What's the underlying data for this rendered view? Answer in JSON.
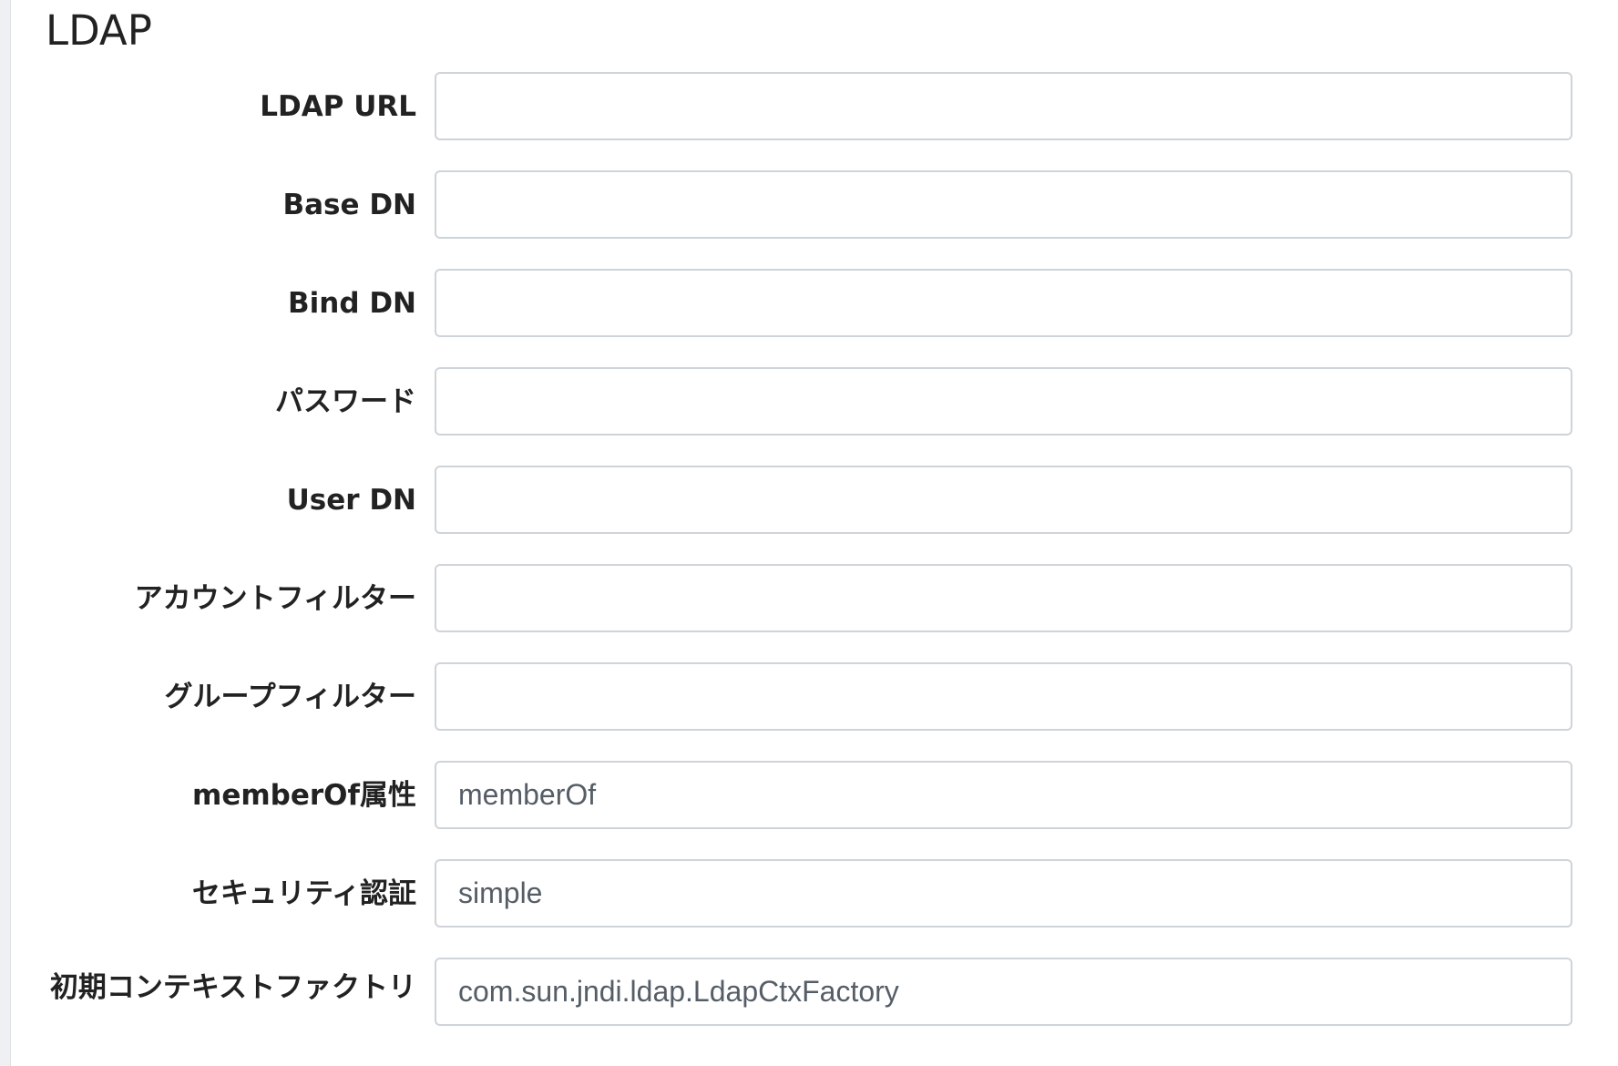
{
  "section": {
    "title": "LDAP"
  },
  "fields": [
    {
      "key": "ldap-url",
      "label": "LDAP URL",
      "value": "",
      "placeholder": ""
    },
    {
      "key": "base-dn",
      "label": "Base DN",
      "value": "",
      "placeholder": ""
    },
    {
      "key": "bind-dn",
      "label": "Bind DN",
      "value": "",
      "placeholder": ""
    },
    {
      "key": "password",
      "label": "パスワード",
      "value": "",
      "placeholder": ""
    },
    {
      "key": "user-dn",
      "label": "User DN",
      "value": "",
      "placeholder": ""
    },
    {
      "key": "account-filter",
      "label": "アカウントフィルター",
      "value": "",
      "placeholder": ""
    },
    {
      "key": "group-filter",
      "label": "グループフィルター",
      "value": "",
      "placeholder": ""
    },
    {
      "key": "memberof-attribute",
      "label": "memberOf属性",
      "value": "",
      "placeholder": "memberOf"
    },
    {
      "key": "security-authentication",
      "label": "セキュリティ認証",
      "value": "",
      "placeholder": "simple"
    },
    {
      "key": "initial-context-factory",
      "label": "初期コンテキストファクトリ",
      "value": "",
      "placeholder": "com.sun.jndi.ldap.LdapCtxFactory"
    }
  ]
}
